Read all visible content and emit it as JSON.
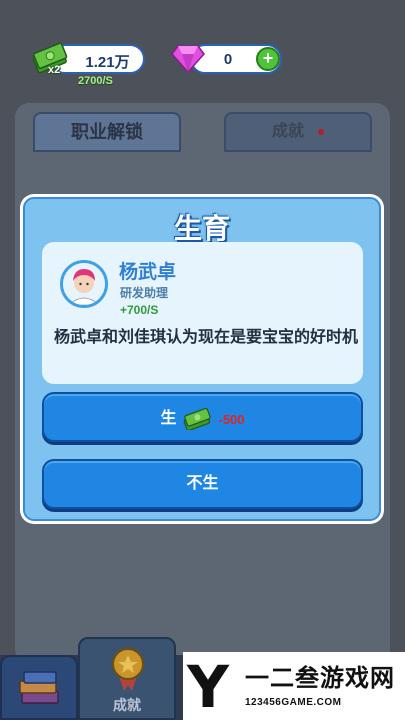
{
  "header": {
    "cash_value": "1.21万",
    "cash_multiplier": "x2",
    "cash_rate": "2700/S",
    "gem_value": "0",
    "icons": [
      "cash-icon",
      "gem-icon",
      "plus-icon"
    ]
  },
  "tabs": [
    {
      "label": "职业解锁"
    },
    {
      "label": "成就"
    }
  ],
  "bottom_nav": {
    "achieve_label": "成就",
    "icons": [
      "books-icon",
      "medal-icon"
    ]
  },
  "dialog": {
    "title": "生育",
    "person": {
      "name": "杨武卓",
      "title": "研发助理",
      "rate": "+700/S"
    },
    "message": "杨武卓和刘佳琪认为现在是要宝宝的好时机",
    "birth_button": {
      "label": "生",
      "cost": "-500"
    },
    "no_birth_button": {
      "label": "不生"
    }
  },
  "watermark": {
    "logo_letter": "Y",
    "name": "一二叁游戏网",
    "url": "123456GAME.COM"
  },
  "colors": {
    "accent": "#1f86e4",
    "dialog_bg": "#7ec3f0",
    "cost": "#e02424",
    "rate_green": "#2f9a3a"
  }
}
